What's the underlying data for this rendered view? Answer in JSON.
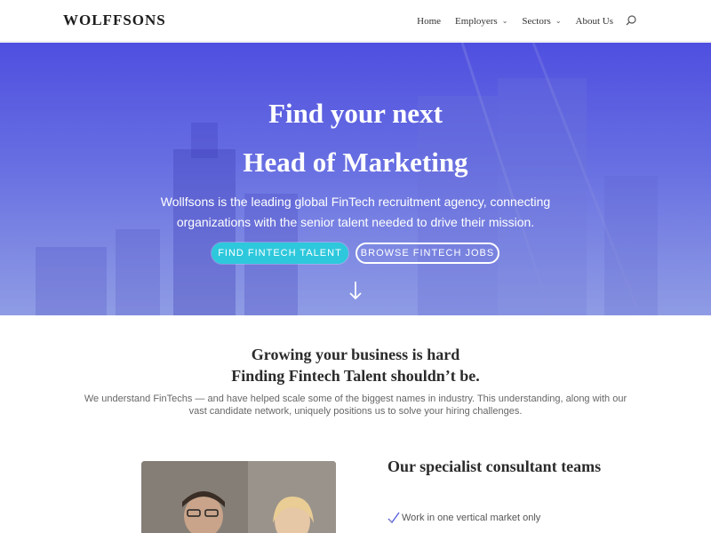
{
  "header": {
    "logo": "WOLFFSONS",
    "nav": [
      {
        "label": "Home",
        "dropdown": false
      },
      {
        "label": "Employers",
        "dropdown": true
      },
      {
        "label": "Sectors",
        "dropdown": true
      },
      {
        "label": "About Us",
        "dropdown": false
      }
    ]
  },
  "hero": {
    "title_line1": "Find your next",
    "title_line2": "Head of Marketing",
    "subtitle": "Wollfsons is the leading global FinTech recruitment agency, connecting organizations with the senior talent needed to drive their mission.",
    "primary_button": "FIND FINTECH TALENT",
    "secondary_button": "BROWSE FINTECH JOBS"
  },
  "intro": {
    "heading_line1": "Growing your business is hard",
    "heading_line2": "Finding Fintech Talent shouldn’t be.",
    "paragraph": "We understand FinTechs — and have helped scale some of the biggest names in industry. This understanding, along with our vast candidate network, uniquely positions us to solve your hiring challenges."
  },
  "teams": {
    "title": "Our specialist consultant teams",
    "items": [
      "Work in one vertical market only"
    ]
  },
  "colors": {
    "hero_top": "#4f4fe0",
    "hero_bottom": "#7686de",
    "accent_button": "#2ec8dc"
  }
}
